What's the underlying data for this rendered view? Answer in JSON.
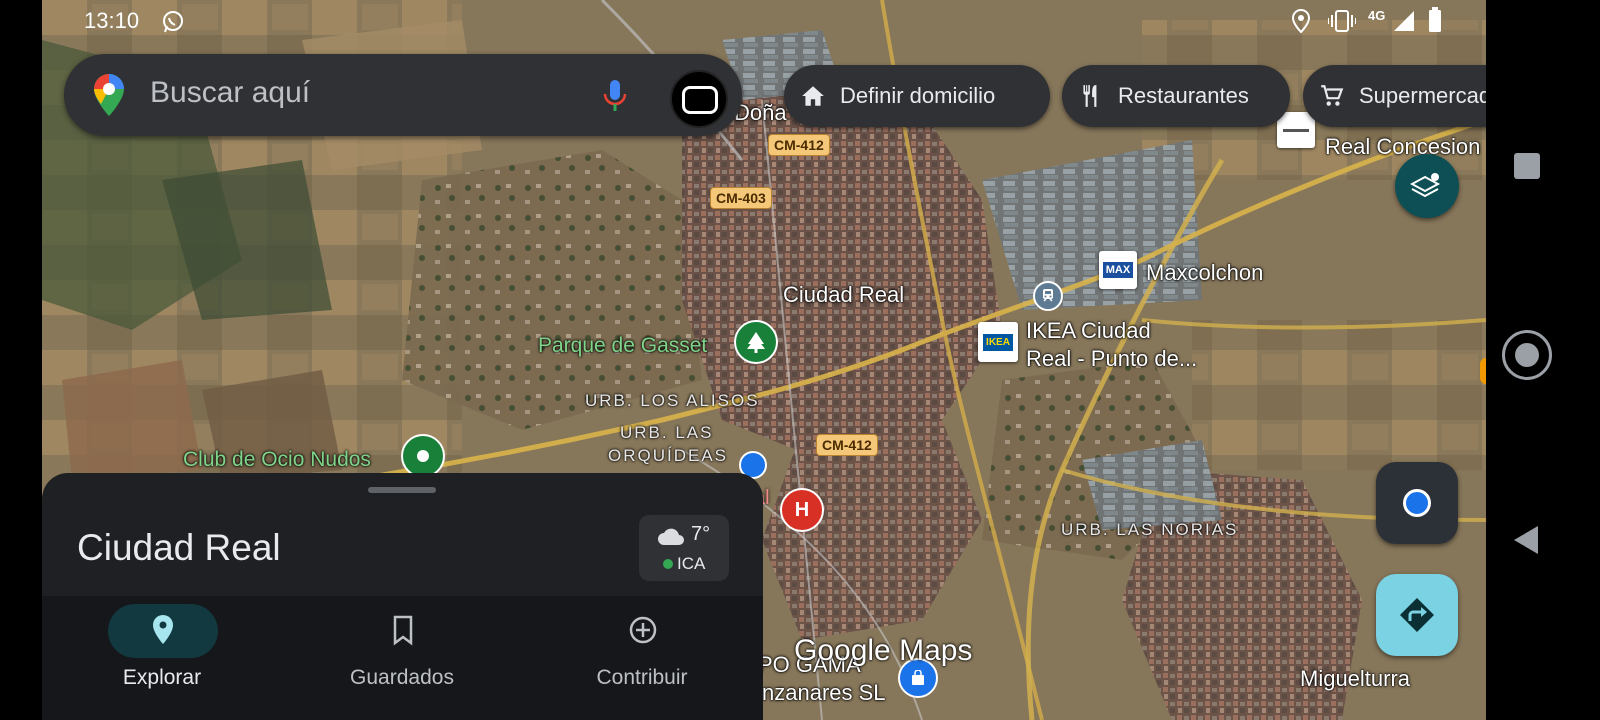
{
  "status_bar": {
    "time": "13:10",
    "network": "4G",
    "icons": [
      "whatsapp-icon",
      "location-icon",
      "vibrate-icon",
      "signal-icon",
      "battery-icon"
    ]
  },
  "search": {
    "placeholder": "Buscar aquí",
    "icons": [
      "google-maps-logo",
      "mic-icon",
      "account-avatar"
    ]
  },
  "chips": [
    {
      "label": "Definir domicilio",
      "icon": "home-icon"
    },
    {
      "label": "Restaurantes",
      "icon": "restaurant-icon"
    },
    {
      "label": "Supermercados",
      "icon": "cart-icon"
    }
  ],
  "map": {
    "labels": {
      "dona": "Doña",
      "city": "Ciudad Real",
      "parque": "Parque de Gasset",
      "alisos": "URB. LOS ALISOS",
      "orquideas_1": "URB. LAS",
      "orquideas_2": "ORQUÍDEAS",
      "club": "Club de Ocio Nudos",
      "maxcolchon": "Maxcolchon",
      "ikea_1": "IKEA Ciudad",
      "ikea_2": "Real - Punto de...",
      "real_concesion": "Real Concesion",
      "norias": "URB. LAS NORIAS",
      "miguelturra": "Miguelturra",
      "pogama": "PO GAMA",
      "manzanares": "nzanares SL",
      "al": "al"
    },
    "roads": [
      "CM-412",
      "CM-403",
      "CM-412"
    ],
    "watermark": "Google Maps",
    "brand_max": "MAX",
    "brand_ikea": "IKEA"
  },
  "sheet": {
    "place_name": "Ciudad Real",
    "temperature": "7°",
    "air_quality": "ICA"
  },
  "bottom_nav": [
    {
      "label": "Explorar",
      "icon": "explore-pin-icon",
      "active": true
    },
    {
      "label": "Guardados",
      "icon": "bookmark-icon",
      "active": false
    },
    {
      "label": "Contribuir",
      "icon": "add-circle-icon",
      "active": false
    }
  ],
  "colors": {
    "sheet_bg": "#1f2023",
    "chip_bg": "#303134",
    "accent_teal": "#0e4f55",
    "directions": "#7ad2e2",
    "location_blue": "#1a73e8"
  }
}
